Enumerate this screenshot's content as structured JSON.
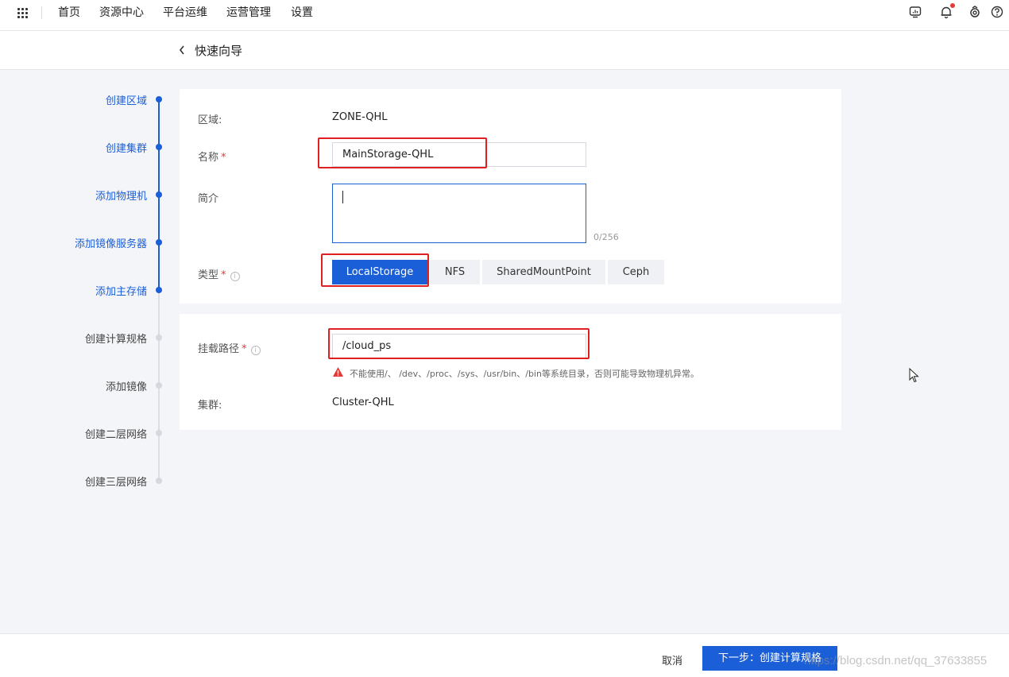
{
  "nav": {
    "items": [
      "首页",
      "资源中心",
      "平台运维",
      "运营管理",
      "设置"
    ]
  },
  "header": {
    "title": "快速向导"
  },
  "steps": [
    {
      "label": "创建区域",
      "status": "done"
    },
    {
      "label": "创建集群",
      "status": "done"
    },
    {
      "label": "添加物理机",
      "status": "done"
    },
    {
      "label": "添加镜像服务器",
      "status": "done"
    },
    {
      "label": "添加主存储",
      "status": "current"
    },
    {
      "label": "创建计算规格",
      "status": "pending"
    },
    {
      "label": "添加镜像",
      "status": "pending"
    },
    {
      "label": "创建二层网络",
      "status": "pending"
    },
    {
      "label": "创建三层网络",
      "status": "pending"
    }
  ],
  "form": {
    "zone_label": "区域:",
    "zone_value": "ZONE-QHL",
    "name_label": "名称",
    "name_value": "MainStorage-QHL",
    "desc_label": "简介",
    "desc_counter": "0/256",
    "type_label": "类型",
    "types": [
      "LocalStorage",
      "NFS",
      "SharedMountPoint",
      "Ceph"
    ],
    "selected_type": "LocalStorage",
    "mount_label": "挂载路径",
    "mount_value": "/cloud_ps",
    "mount_warning": "不能使用/、 /dev、/proc、/sys、/usr/bin、/bin等系统目录，否则可能导致物理机异常。",
    "cluster_label": "集群:",
    "cluster_value": "Cluster-QHL",
    "required_mark": "*",
    "info_mark": "i"
  },
  "footer": {
    "cancel_label": "取消",
    "next_label": "下一步：创建计算规格"
  },
  "watermark": "https://blog.csdn.net/qq_37633855",
  "colors": {
    "accent": "#1a5fd8",
    "annotation": "#e02020",
    "required": "#e53935"
  }
}
